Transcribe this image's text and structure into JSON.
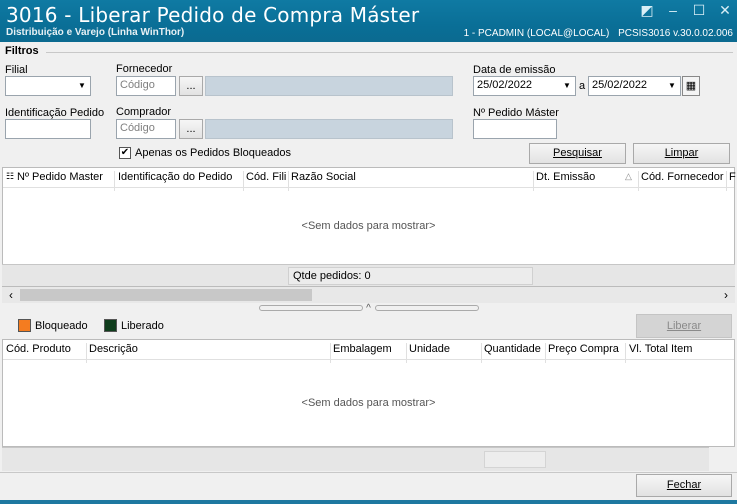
{
  "window": {
    "title": "3016 - Liberar Pedido de Compra Máster",
    "subtitle": "Distribuição e Varejo (Linha WinThor)",
    "user_info": "1 - PCADMIN (LOCAL@LOCAL)",
    "program_version": "PCSIS3016  v.30.0.02.006",
    "buttons": [
      "restore",
      "minimize",
      "maximize",
      "close"
    ]
  },
  "filters": {
    "group_title": "Filtros",
    "filial_label": "Filial",
    "filial_value": "",
    "fornecedor_label": "Fornecedor",
    "fornecedor_placeholder": "Código",
    "fornecedor_name": "",
    "lookup_button": "...",
    "data_emissao_label": "Data de emissão",
    "date_from": "25/02/2022",
    "date_sep": "a",
    "date_to": "25/02/2022",
    "identificacao_label": "Identificação Pedido",
    "identificacao_value": "",
    "comprador_label": "Comprador",
    "comprador_placeholder": "Código",
    "comprador_name": "",
    "pedido_master_label": "Nº Pedido Máster",
    "pedido_master_value": "",
    "checkbox_label": "Apenas os Pedidos Bloqueados",
    "checkbox_checked": true,
    "pesquisar_label": "Pesquisar",
    "limpar_label": "Limpar"
  },
  "grid_pedidos": {
    "columns": [
      "Nº Pedido Master",
      "Identificação do Pedido",
      "Cód. Fili",
      "Razão Social",
      "Dt. Emissão",
      "Cód. Fornecedor",
      "F"
    ],
    "empty_text": "<Sem dados para mostrar>",
    "qtde_text": "Qtde pedidos: 0"
  },
  "legend": {
    "bloqueado_label": "Bloqueado",
    "bloqueado_color": "#f47c20",
    "liberado_label": "Liberado",
    "liberado_color": "#0f3d1c",
    "liberar_label": "Liberar"
  },
  "grid_itens": {
    "columns": [
      "Cód. Produto",
      "Descrição",
      "Embalagem",
      "Unidade",
      "Quantidade",
      "Preço Compra",
      "Vl. Total Item"
    ],
    "empty_text": "<Sem dados para mostrar>"
  },
  "footer": {
    "fechar_label": "Fechar"
  },
  "colors": {
    "titlebar": "#0f7aa3",
    "disabled_field": "#c8d4de"
  }
}
